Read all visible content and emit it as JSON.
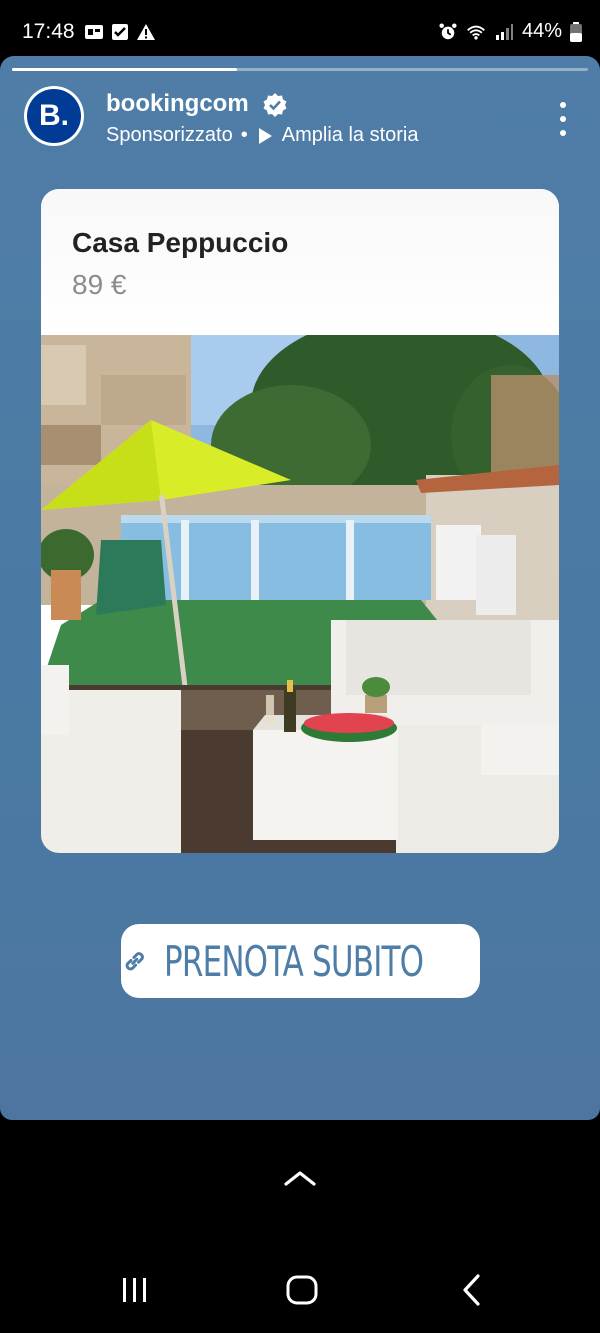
{
  "status_bar": {
    "time": "17:48",
    "left_icons": [
      "sim-card-icon",
      "checkbox-icon",
      "warning-icon"
    ],
    "right_icons": [
      "alarm-icon",
      "wifi-icon",
      "signal-icon"
    ],
    "battery": "44%"
  },
  "story": {
    "progress": 0.39,
    "account": {
      "avatar_letter": "B.",
      "name": "bookingcom",
      "verified": true,
      "sponsored": "Sponsorizzato",
      "separator": "•",
      "expand_label": "Amplia la storia"
    },
    "card": {
      "title": "Casa Peppuccio",
      "price": "89 €",
      "image_description": "garden patio with pool, yellow umbrella and white wicker furniture"
    },
    "cta": {
      "label": "PRENOTA SUBITO",
      "icon": "link-icon"
    }
  },
  "nav": {
    "swipe_up_icon": "chevron-up-icon",
    "buttons": [
      "recents-icon",
      "home-icon",
      "back-icon"
    ]
  },
  "colors": {
    "story_bg": "#4f7da7",
    "brand_blue": "#003b95",
    "cta_text": "#4e7ea8"
  }
}
